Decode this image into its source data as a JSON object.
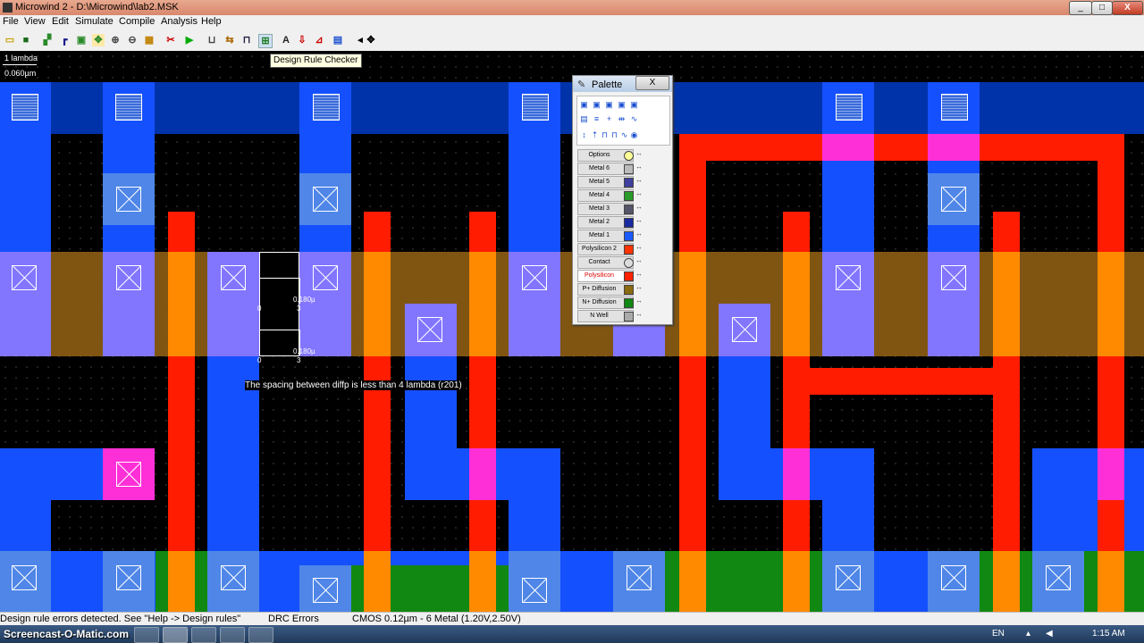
{
  "window": {
    "title": "Microwind 2 - D:\\Microwind\\lab2.MSK",
    "minimize": "_",
    "maximize": "□",
    "close": "X"
  },
  "menu": [
    "File",
    "View",
    "Edit",
    "Simulate",
    "Compile",
    "Analysis",
    "Help"
  ],
  "toolbar": {
    "tooltip": "Design Rule Checker",
    "icons": [
      "open-icon",
      "save-icon",
      "draw-box-icon",
      "draw-line-icon",
      "copy-icon",
      "move-icon",
      "zoom-in-icon",
      "zoom-out-icon",
      "fit-icon",
      "cut-icon",
      "stretch-icon",
      "connect-icon",
      "drc-icon",
      "text-icon",
      "cross-section-icon",
      "measure-icon",
      "simulate-icon",
      "arrows-icon"
    ]
  },
  "canvas": {
    "scale_lambda": "1 lambda",
    "scale_um": "0.060µm",
    "ruler1": {
      "label": "0.180µ",
      "start": "0",
      "end": "3"
    },
    "ruler2": {
      "label": "0.180µ",
      "start": "0",
      "end": "3"
    },
    "drc_message": "The  spacing between diffp is less than 4 lambda (r201)"
  },
  "palette": {
    "title": "Palette",
    "close": "X",
    "layers": [
      {
        "label": "Options",
        "color": "#ffff99"
      },
      {
        "label": "Metal 6",
        "color": "#bbbbbb"
      },
      {
        "label": "Metal 5",
        "color": "#3f3f9f"
      },
      {
        "label": "Metal 4",
        "color": "#2a9a2a"
      },
      {
        "label": "Metal 3",
        "color": "#55556a"
      },
      {
        "label": "Metal 2",
        "color": "#1a2aa0"
      },
      {
        "label": "Metal 1",
        "color": "#1a5aff"
      },
      {
        "label": "Polysilicon 2",
        "color": "#ff3300"
      },
      {
        "label": "Contact",
        "color": "#dddddd"
      },
      {
        "label": "Polysilicon",
        "color": "#ff2200"
      },
      {
        "label": "P+ Diffusion",
        "color": "#8a6a10"
      },
      {
        "label": "N+ Diffusion",
        "color": "#118811"
      },
      {
        "label": "N Well",
        "color": "#aaaaaa"
      }
    ]
  },
  "status": {
    "message": "Design rule errors detected. See \"Help -> Design rules\"",
    "drc": "DRC Errors",
    "tech": "CMOS 0.12µm - 6 Metal (1.20V,2.50V)"
  },
  "taskbar": {
    "watermark": "Screencast-O-Matic.com",
    "lang": "EN",
    "time": "1:15 AM"
  }
}
